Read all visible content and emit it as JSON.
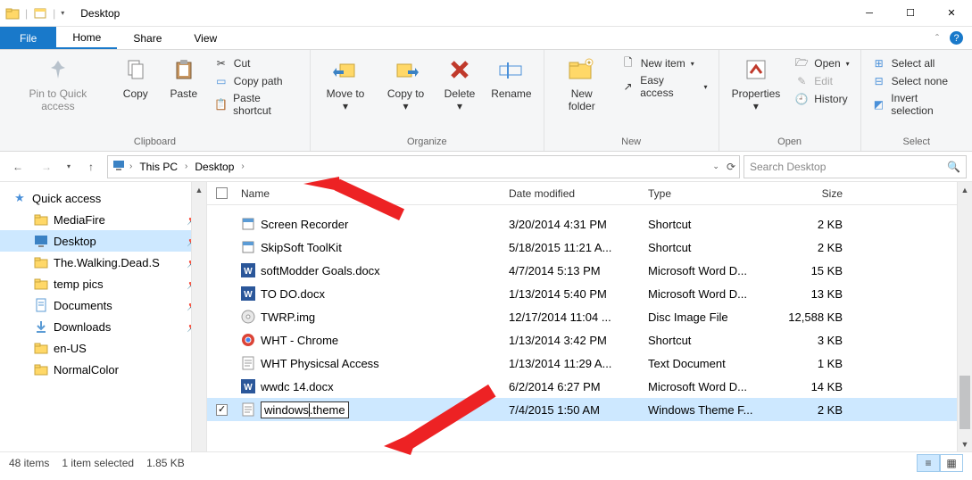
{
  "window": {
    "title": "Desktop"
  },
  "tabs": {
    "file": "File",
    "home": "Home",
    "share": "Share",
    "view": "View"
  },
  "ribbon": {
    "clipboard": {
      "label": "Clipboard",
      "pin": "Pin to Quick access",
      "copy": "Copy",
      "paste": "Paste",
      "cut": "Cut",
      "copypath": "Copy path",
      "pasteshort": "Paste shortcut"
    },
    "organize": {
      "label": "Organize",
      "moveto": "Move to",
      "copyto": "Copy to",
      "delete": "Delete",
      "rename": "Rename"
    },
    "new": {
      "label": "New",
      "newfolder": "New folder",
      "newitem": "New item",
      "easyaccess": "Easy access"
    },
    "open": {
      "label": "Open",
      "properties": "Properties",
      "open": "Open",
      "edit": "Edit",
      "history": "History"
    },
    "select": {
      "label": "Select",
      "all": "Select all",
      "none": "Select none",
      "invert": "Invert selection"
    }
  },
  "breadcrumb": {
    "pc": "This PC",
    "desktop": "Desktop"
  },
  "search": {
    "placeholder": "Search Desktop"
  },
  "nav": {
    "qa": "Quick access",
    "items": [
      {
        "label": "MediaFire",
        "pin": true
      },
      {
        "label": "Desktop",
        "pin": true
      },
      {
        "label": "The.Walking.Dead.S",
        "pin": true
      },
      {
        "label": "temp pics",
        "pin": true
      },
      {
        "label": "Documents",
        "pin": true
      },
      {
        "label": "Downloads",
        "pin": true
      },
      {
        "label": "en-US",
        "pin": false
      },
      {
        "label": "NormalColor",
        "pin": false
      }
    ]
  },
  "columns": {
    "name": "Name",
    "date": "Date modified",
    "type": "Type",
    "size": "Size"
  },
  "files": [
    {
      "name": "Screen Recorder",
      "date": "3/20/2014 4:31 PM",
      "type": "Shortcut",
      "size": "2 KB",
      "icon": "app"
    },
    {
      "name": "SkipSoft ToolKit",
      "date": "5/18/2015 11:21 A...",
      "type": "Shortcut",
      "size": "2 KB",
      "icon": "app"
    },
    {
      "name": "softModder Goals.docx",
      "date": "4/7/2014 5:13 PM",
      "type": "Microsoft Word D...",
      "size": "15 KB",
      "icon": "word"
    },
    {
      "name": "TO DO.docx",
      "date": "1/13/2014 5:40 PM",
      "type": "Microsoft Word D...",
      "size": "13 KB",
      "icon": "word"
    },
    {
      "name": "TWRP.img",
      "date": "12/17/2014 11:04 ...",
      "type": "Disc Image File",
      "size": "12,588 KB",
      "icon": "disc"
    },
    {
      "name": "WHT - Chrome",
      "date": "1/13/2014 3:42 PM",
      "type": "Shortcut",
      "size": "3 KB",
      "icon": "chrome"
    },
    {
      "name": "WHT Physicsal Access",
      "date": "1/13/2014 11:29 A...",
      "type": "Text Document",
      "size": "1 KB",
      "icon": "txt"
    },
    {
      "name": "wwdc 14.docx",
      "date": "6/2/2014 6:27 PM",
      "type": "Microsoft Word D...",
      "size": "14 KB",
      "icon": "word"
    }
  ],
  "editing": {
    "name": "windows.theme",
    "date": "7/4/2015 1:50 AM",
    "type": "Windows Theme F...",
    "size": "2 KB"
  },
  "status": {
    "items": "48 items",
    "selected": "1 item selected",
    "size": "1.85 KB"
  }
}
